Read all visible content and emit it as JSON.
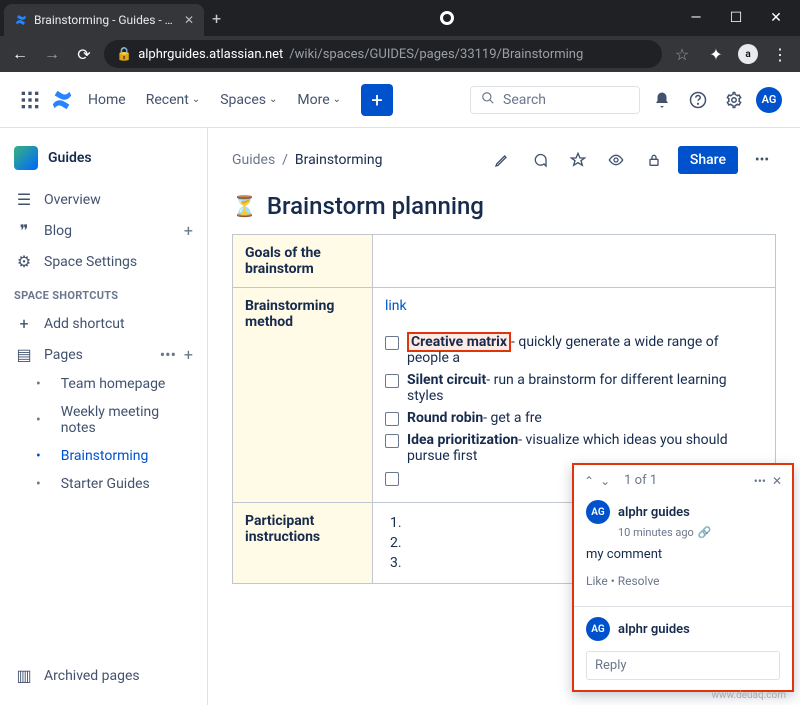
{
  "browser": {
    "tab_title": "Brainstorming - Guides - Conflue",
    "url_host": "alphrguides.atlassian.net",
    "url_path": "/wiki/spaces/GUIDES/pages/33119/Brainstorming"
  },
  "topnav": {
    "links": {
      "home": "Home",
      "recent": "Recent",
      "spaces": "Spaces",
      "more": "More"
    },
    "search_placeholder": "Search",
    "avatar_initials": "AG"
  },
  "sidebar": {
    "space_name": "Guides",
    "overview": "Overview",
    "blog": "Blog",
    "space_settings": "Space Settings",
    "shortcuts_heading": "SPACE SHORTCUTS",
    "add_shortcut": "Add shortcut",
    "pages": "Pages",
    "page_items": [
      "Team homepage",
      "Weekly meeting notes",
      "Brainstorming",
      "Starter Guides"
    ],
    "archived": "Archived pages"
  },
  "page": {
    "breadcrumb_root": "Guides",
    "breadcrumb_current": "Brainstorming",
    "share_label": "Share",
    "title": "Brainstorm planning",
    "emoji": "⏳",
    "table": {
      "row1_label": "Goals of the brainstorm",
      "row2_label": "Brainstorming method",
      "row2_link": "link",
      "methods": {
        "m1_name": "Creative matrix",
        "m1_rest": "- quickly generate a wide range of people a",
        "m2_name": "Silent circuit",
        "m2_rest": "- run a brainstorm for different learning styles",
        "m3_name": "Round robin",
        "m3_rest": "- get a fre",
        "m4_name": "Idea prioritization",
        "m4_rest": "- visualize which ideas you should pursue first"
      },
      "row3_label": "Participant instructions",
      "row3_items": [
        "",
        "",
        ""
      ]
    }
  },
  "comment": {
    "counter": "1 of 1",
    "user_name": "alphr guides",
    "user_initials": "AG",
    "timestamp": "10 minutes ago",
    "body": "my comment",
    "like": "Like",
    "resolve": "Resolve",
    "reply_user": "alphr guides",
    "reply_placeholder": "Reply"
  },
  "watermark": "www.deuaq.com"
}
